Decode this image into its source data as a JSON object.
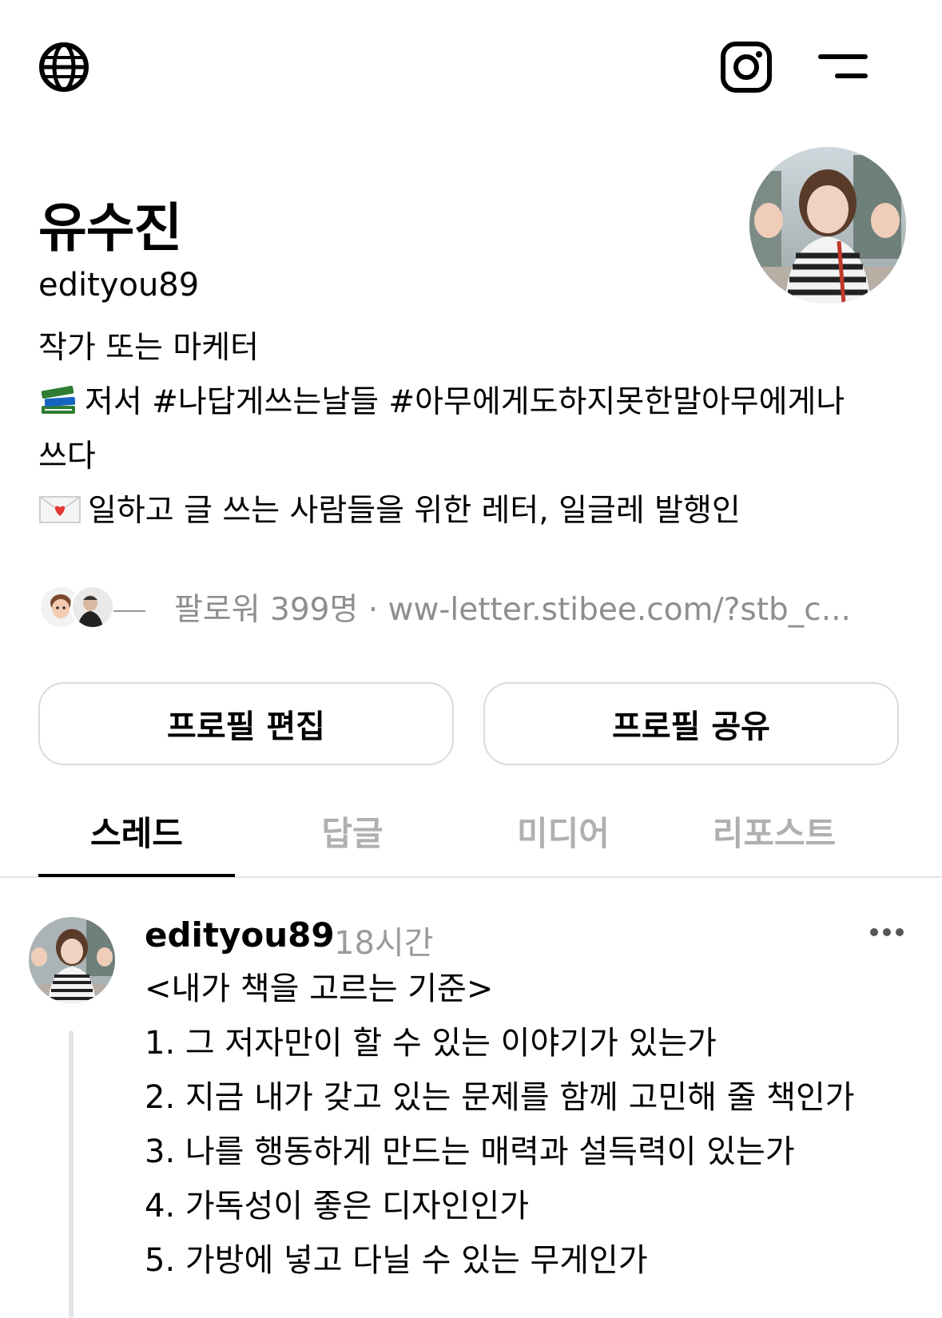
{
  "profile": {
    "display_name": "유수진",
    "username": "edityou89",
    "bio": {
      "line1": "작가 또는 마케터",
      "line2": "저서 #나답게쓰는날들 #아무에게도하지못한말아무에게나",
      "line3": "쓰다",
      "line4": "일하고 글 쓰는 사람들을 위한 레터, 일글레 발행인"
    },
    "followers_text": "팔로워 399명 · ww-letter.stibee.com/?stb_c..."
  },
  "buttons": {
    "edit_profile": "프로필 편집",
    "share_profile": "프로필 공유"
  },
  "tabs": [
    {
      "label": "스레드",
      "active": true
    },
    {
      "label": "답글",
      "active": false
    },
    {
      "label": "미디어",
      "active": false
    },
    {
      "label": "리포스트",
      "active": false
    }
  ],
  "post": {
    "author": "edityou89",
    "time": "18시간",
    "lines": [
      "<내가 책을 고르는 기준>",
      "1. 그 저자만이 할 수 있는 이야기가 있는가",
      "2. 지금 내가 갖고 있는 문제를 함께 고민해 줄 책인가",
      "3. 나를 행동하게 만드는 매력과 설득력이 있는가",
      "4. 가독성이 좋은 디자인인가",
      "5. 가방에 넣고 다닐 수 있는 무게인가"
    ]
  },
  "icons": {
    "top_left": "globe-icon",
    "top_right_1": "instagram-icon",
    "top_right_2": "menu-icon",
    "bio_line2": "books-emoji-icon",
    "bio_line4": "love-letter-emoji-icon",
    "post_more": "more-dots-icon"
  },
  "colors": {
    "muted_text": "#8e8e8e",
    "inactive_tab": "#b0b0b0",
    "border": "#dbdbdb"
  }
}
